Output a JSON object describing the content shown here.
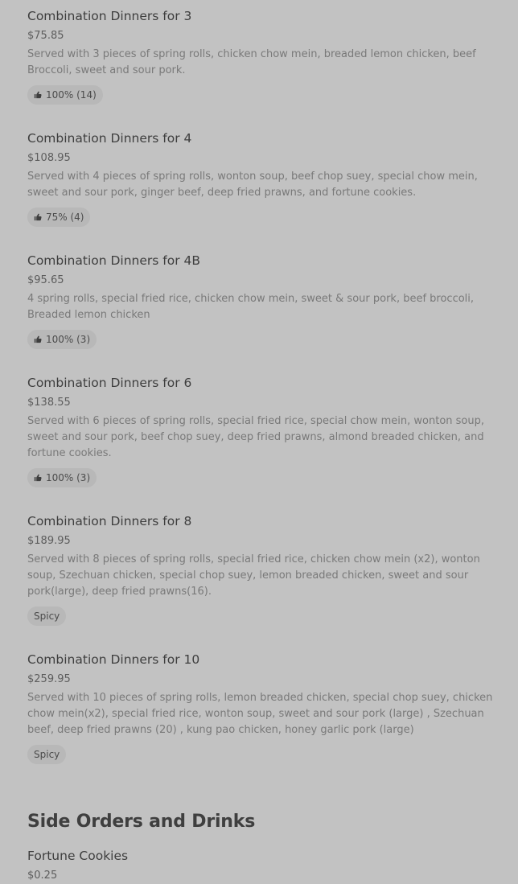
{
  "menu": {
    "items": [
      {
        "name": "Combination Dinners for 3",
        "price": "$75.85",
        "description": "Served with 3 pieces of spring rolls, chicken chow mein, breaded lemon chicken, beef Broccoli, sweet and sour pork.",
        "badge": "100% (14)",
        "badge_icon": "thumbs-up-icon"
      },
      {
        "name": "Combination Dinners for 4",
        "price": "$108.95",
        "description": "Served with 4 pieces of spring rolls, wonton soup, beef chop suey, special chow mein, sweet and sour pork, ginger beef, deep fried prawns, and fortune cookies.",
        "badge": "75% (4)",
        "badge_icon": "thumbs-up-icon"
      },
      {
        "name": "Combination Dinners for 4B",
        "price": "$95.65",
        "description": "4 spring rolls, special fried rice, chicken chow mein, sweet & sour pork, beef broccoli, Breaded lemon chicken",
        "badge": "100% (3)",
        "badge_icon": "thumbs-up-icon"
      },
      {
        "name": "Combination Dinners for 6",
        "price": "$138.55",
        "description": "Served with 6 pieces of spring rolls, special fried rice, special chow mein, wonton soup, sweet and sour pork, beef chop suey, deep fried prawns, almond breaded chicken, and fortune cookies.",
        "badge": "100% (3)",
        "badge_icon": "thumbs-up-icon"
      },
      {
        "name": "Combination Dinners for 8",
        "price": "$189.95",
        "description": "Served with 8 pieces of spring rolls, special fried rice, chicken chow mein (x2), wonton soup, Szechuan chicken, special chop suey, lemon breaded chicken, sweet and sour pork(large), deep fried prawns(16).",
        "badge": "Spicy"
      },
      {
        "name": "Combination Dinners for 10",
        "price": "$259.95",
        "description": "Served with 10 pieces of spring rolls, lemon breaded chicken, special chop suey, chicken chow mein(x2), special fried rice, wonton soup, sweet and sour pork (large) , Szechuan beef, deep fried prawns (20) , kung pao chicken, honey garlic pork (large)",
        "badge": "Spicy"
      }
    ]
  },
  "side_section": {
    "title": "Side Orders and Drinks",
    "items": [
      {
        "name": "Fortune Cookies",
        "price": "$0.25"
      }
    ]
  }
}
